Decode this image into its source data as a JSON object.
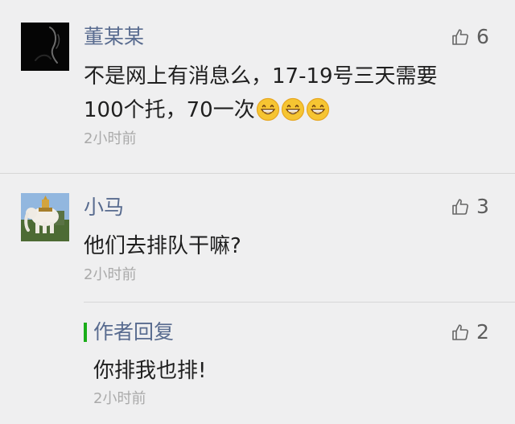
{
  "comments": [
    {
      "author": "董某某",
      "text_line1": "不是网上有消息么，17-19号三天需要",
      "text_line2": "100个托，70一次",
      "time": "2小时前",
      "likes": "6",
      "emoji_count": 3
    },
    {
      "author": "小马",
      "text": "他们去排队干嘛?",
      "time": "2小时前",
      "likes": "3"
    }
  ],
  "reply": {
    "label": "作者回复",
    "text": "你排我也排!",
    "time": "2小时前",
    "likes": "2"
  },
  "icons": {
    "like": "thumbs-up-icon",
    "emoji": "grinning-emoji"
  },
  "colors": {
    "background": "#efeff0",
    "name": "#586b8f",
    "text": "#1f1f1f",
    "time": "#aaaaaa",
    "reply_mark": "#1aad19",
    "divider": "#d7d7d7"
  }
}
